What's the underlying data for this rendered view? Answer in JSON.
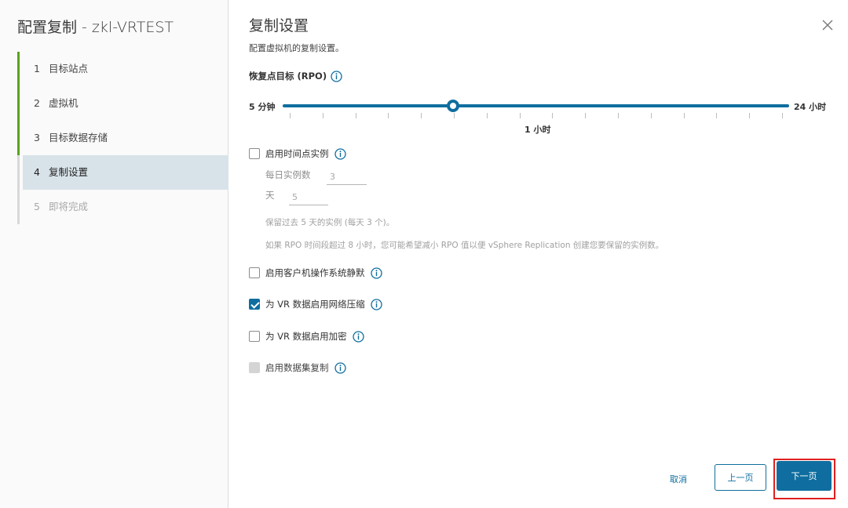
{
  "wizard": {
    "title": "配置复制 - zkl-VRTEST",
    "steps": [
      {
        "num": "1",
        "label": "目标站点",
        "state": "done"
      },
      {
        "num": "2",
        "label": "虚拟机",
        "state": "done"
      },
      {
        "num": "3",
        "label": "目标数据存储",
        "state": "done"
      },
      {
        "num": "4",
        "label": "复制设置",
        "state": "active"
      },
      {
        "num": "5",
        "label": "即将完成",
        "state": "pending"
      }
    ]
  },
  "page": {
    "title": "复制设置",
    "subtitle": "配置虚拟机的复制设置。",
    "close_icon": "close-icon"
  },
  "rpo": {
    "label": "恢复点目标 (RPO)",
    "min_label": "5 分钟",
    "max_label": "24 小时",
    "mid_label": "1 小时",
    "current_value": "1 小时"
  },
  "pit": {
    "label": "启用时间点实例",
    "checked": false,
    "instances_label": "每日实例数",
    "instances_value": "3",
    "days_label": "天",
    "days_value": "5",
    "note1": "保留过去 5 天的实例 (每天 3 个)。",
    "note2": "如果 RPO 时间段超过 8 小时，您可能希望减小 RPO 值以便 vSphere Replication 创建您要保留的实例数。"
  },
  "options": [
    {
      "label": "启用客户机操作系统静默",
      "checked": false,
      "disabled": false
    },
    {
      "label": "为 VR 数据启用网络压缩",
      "checked": true,
      "disabled": false
    },
    {
      "label": "为 VR 数据启用加密",
      "checked": false,
      "disabled": false
    },
    {
      "label": "启用数据集复制",
      "checked": false,
      "disabled": true
    }
  ],
  "footer": {
    "cancel": "取消",
    "prev": "上一页",
    "next": "下一页"
  },
  "colors": {
    "accent": "#0f6e9f",
    "done": "#5aa220",
    "highlight": "#e02020"
  }
}
